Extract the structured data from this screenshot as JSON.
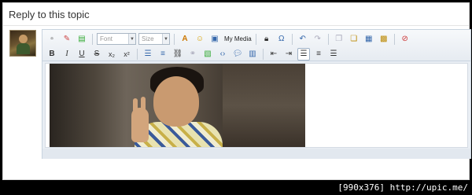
{
  "reply": {
    "title": "Reply to this topic"
  },
  "toolbar": {
    "font_placeholder": "Font",
    "size_placeholder": "Size",
    "media_label": "My Media",
    "row1": [
      "source",
      "remove-format",
      "paste-text",
      "font-color",
      "emoticon",
      "media",
      "lock",
      "special-char",
      "undo",
      "redo",
      "cut",
      "copy",
      "paste",
      "paste-word",
      "spellcheck"
    ],
    "row2": [
      "B",
      "I",
      "U",
      "S",
      "x2",
      "x2sup",
      "ul",
      "ol",
      "link",
      "unlink",
      "image",
      "code",
      "quote",
      "spoiler",
      "indent",
      "outdent",
      "align-left",
      "align-center",
      "align-right"
    ]
  },
  "glyphs": {
    "B": "B",
    "I": "I",
    "U": "U",
    "S": "S",
    "sub": "x₂",
    "sup": "x²"
  },
  "watermark": "[990x376] http://upic.me/"
}
